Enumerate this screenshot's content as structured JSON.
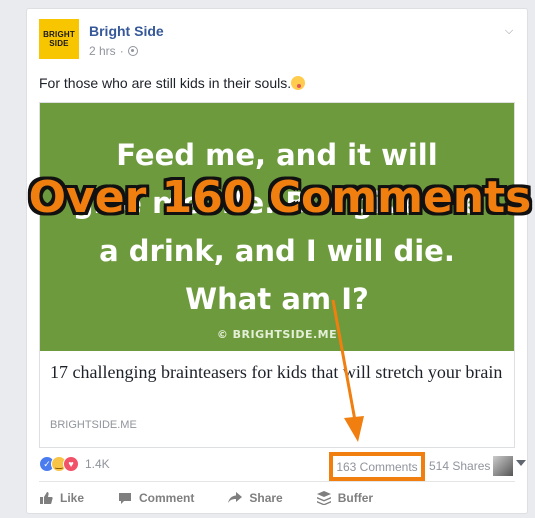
{
  "post": {
    "page_name": "Bright Side",
    "avatar_text_line1": "BRIGHT",
    "avatar_text_line2": "SIDE",
    "time": "2 hrs",
    "separator": "·",
    "text": "For those who are still kids in their souls.",
    "emoji_icon": "crazy-face-emoji"
  },
  "link_preview": {
    "image_lines": [
      "Feed me, and it will",
      "give me life. But give me",
      "a drink, and I will die.",
      "What am I?"
    ],
    "image_bg_color": "#6e9a3e",
    "watermark": "© BRIGHTSIDE.ME",
    "title": "17 challenging brainteasers for kids that will stretch your brain",
    "domain": "BRIGHTSIDE.ME"
  },
  "overlay": {
    "label": "Over 160 Comments",
    "highlight_color": "#f07f10"
  },
  "stats": {
    "reaction_icons": [
      "like-icon",
      "haha-icon",
      "love-icon"
    ],
    "reactions_count": "1.4K",
    "comments_count": "163 Comments",
    "shares_count": "514 Shares"
  },
  "actions": {
    "like_label": "Like",
    "comment_label": "Comment",
    "share_label": "Share",
    "buffer_label": "Buffer"
  }
}
